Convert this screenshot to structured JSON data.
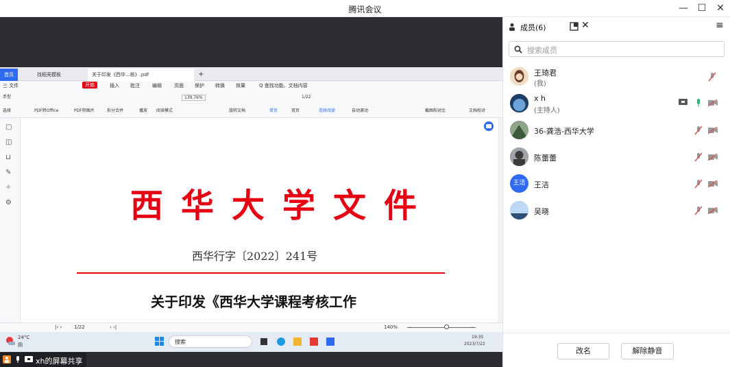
{
  "window": {
    "title": "腾讯会议"
  },
  "share_window": {
    "tabs": [
      "首页",
      "找稻壳模板",
      "关于印发《西华...核》.pdf",
      "+"
    ],
    "menu": [
      "三 文件",
      "开始",
      "插入",
      "批注",
      "编辑",
      "页面",
      "保护",
      "转换",
      "效果",
      "Q 查找功能、文档内容"
    ],
    "toolbar": {
      "items": [
        "手型",
        "选择",
        "PDF转Office",
        "PDF转图片",
        "拆分合并",
        "播放",
        "阅读模式",
        "旋转文档",
        "单页",
        "双页",
        "连续阅读",
        "自动滚动",
        "截图和对比",
        "文档校对"
      ],
      "zoom": "139.76%",
      "page": "1/22"
    },
    "document": {
      "title": "西华大学文件",
      "doc_number": "西华行字〔2022〕241号",
      "heading": "关于印发《西华大学课程考核工作"
    },
    "status": {
      "page": "1/22",
      "zoom": "140%"
    },
    "taskbar": {
      "weather_temp": "24°C",
      "weather_desc": "阴",
      "search": "搜索",
      "time": "19:35",
      "date": "2023/7/22"
    }
  },
  "share_bar": {
    "label": "xh的屏幕共享"
  },
  "panel": {
    "header": "成员(6)",
    "search_placeholder": "搜索成员",
    "members": [
      {
        "name": "王琦君",
        "sub": "(我)"
      },
      {
        "name": "x h",
        "sub": "(主持人)"
      },
      {
        "name": "36-龚浩-西华大学",
        "sub": ""
      },
      {
        "name": "陈蕾蕾",
        "sub": ""
      },
      {
        "name": "王洁",
        "sub": "",
        "avatar_text": "王洁"
      },
      {
        "name": "吴晓",
        "sub": ""
      }
    ],
    "buttons": {
      "rename": "改名",
      "unmute": "解除静音"
    }
  },
  "colors": {
    "accent": "#2f6bf2",
    "doc_red": "#e60012",
    "mic_muted": "#d9534f"
  }
}
